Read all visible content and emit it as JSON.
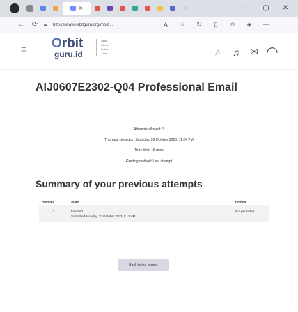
{
  "browser": {
    "url": "https://www.orbitguru.org/mod/...",
    "window_controls": [
      "—",
      "▢",
      "✕"
    ],
    "tabs": [
      {
        "label": "",
        "color": "#2f6fd6"
      },
      {
        "label": "",
        "color": "#f1a34a"
      },
      {
        "label": "",
        "color": "#6aaa55"
      },
      {
        "label": "",
        "color": "#e0564d"
      },
      {
        "label": "",
        "color": "#6b49b5"
      },
      {
        "label": "",
        "color": "#7a8cff"
      },
      {
        "label": "",
        "color": "#35a49b"
      },
      {
        "label": "",
        "color": "#5b6ac4"
      },
      {
        "label": "",
        "color": "#a04ad0"
      },
      {
        "label": "",
        "color": "#5f6b89"
      }
    ],
    "new_tab": "+"
  },
  "header": {
    "logo_main": "rbit",
    "logo_o": "O",
    "logo_sub": "guru",
    "logo_dot": ".",
    "logo_id": "id",
    "tagline": "Skills\nCareer\nFuture\nJobs"
  },
  "page": {
    "title": "AIJ0607E2302-Q04 Professional Email",
    "attempts_allowed": "Attempts allowed: 3",
    "closed_note": "This quiz closed on Saturday, 28 October 2023, 11:04 PM",
    "time_limit": "Time limit: 15 mins",
    "grading_method": "Grading method: Last attempt",
    "summary_title": "Summary of your previous attempts",
    "table": {
      "headers": [
        "Attempt",
        "State",
        "Review"
      ],
      "rows": [
        {
          "attempt": "1",
          "state_line1": "Finished",
          "state_line2": "Submitted Monday, 23 October 2023, 9:12 AM",
          "review": "Not permitted"
        }
      ]
    },
    "back_button": "Back to the course"
  }
}
